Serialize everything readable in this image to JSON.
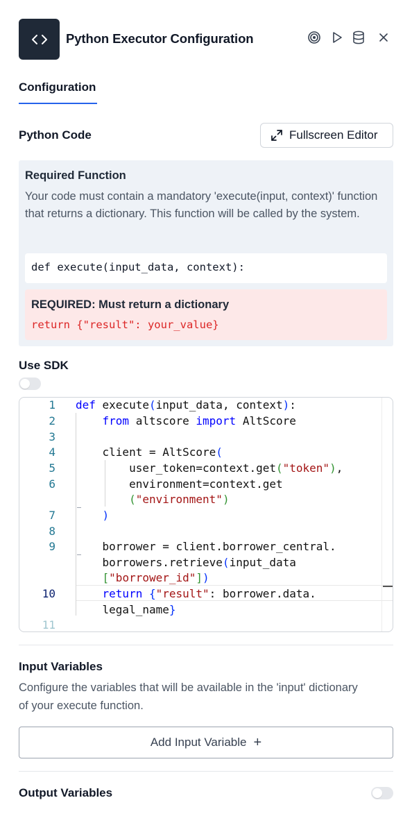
{
  "header": {
    "title": "Python Executor Configuration",
    "icons": [
      "code-icon",
      "target-icon",
      "play-icon",
      "database-icon",
      "close-icon"
    ]
  },
  "tabs": [
    {
      "label": "Configuration",
      "active": true
    }
  ],
  "python_code": {
    "label": "Python Code",
    "fullscreen_button": "Fullscreen Editor"
  },
  "required_function": {
    "title": "Required Function",
    "description": "Your code must contain a mandatory 'execute(input, context)' function that returns a dictionary. This function will be called by the system.",
    "signature": "def execute(input_data, context):",
    "must_title": "REQUIRED: Must return a dictionary",
    "must_code": "return {\"result\": your_value}"
  },
  "use_sdk": {
    "label": "Use SDK",
    "enabled": false
  },
  "editor": {
    "line_numbers": [
      "1",
      "2",
      "3",
      "4",
      "5",
      "6",
      "7",
      "8",
      "9",
      "10",
      "11"
    ],
    "current_line": 10,
    "lines": [
      "def execute(input_data, context):",
      "    from altscore import AltScore",
      "",
      "    client = AltScore(",
      "        user_token=context.get(\"token\"),",
      "        environment=context.get(\"environment\")",
      "    )",
      "",
      "    borrower = client.borrower_central.borrowers.retrieve(input_data[\"borrower_id\"])",
      "    return {\"result\": borrower.data.legal_name}",
      ""
    ]
  },
  "input_variables": {
    "title": "Input Variables",
    "description": "Configure the variables that will be available in the 'input' dictionary of your execute function.",
    "add_button": "Add Input Variable",
    "add_icon": "+"
  },
  "output_variables": {
    "title": "Output Variables",
    "enabled": false
  },
  "colors": {
    "accent": "#2563eb",
    "header_icon_bg": "#1f2937",
    "info_bg": "#eef2f7",
    "warning_bg": "#fde8e8",
    "warning_code": "#dc2626"
  }
}
